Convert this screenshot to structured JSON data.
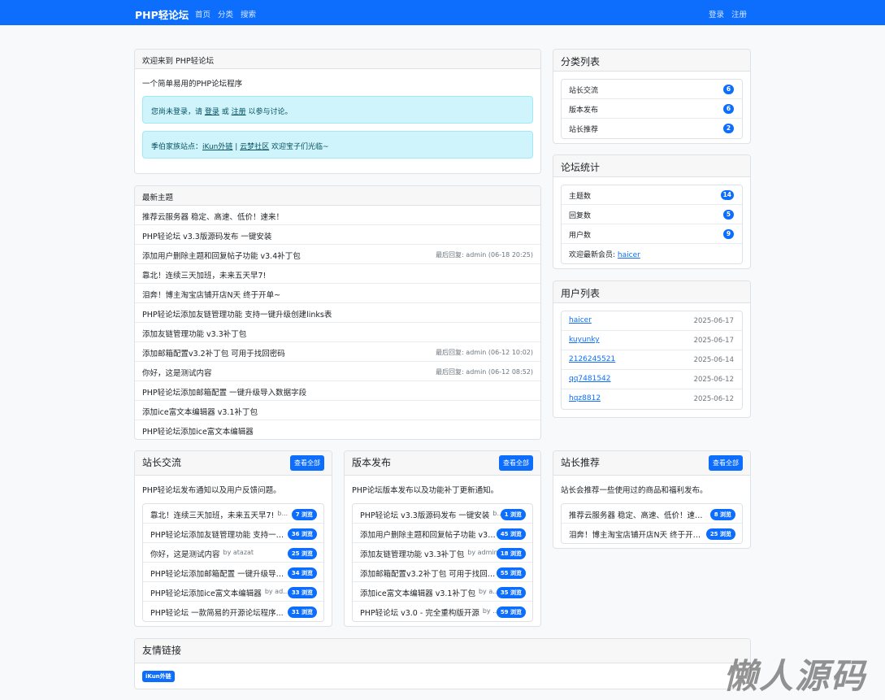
{
  "nav": {
    "brand": "PHP轻论坛",
    "links": [
      "首页",
      "分类",
      "搜索"
    ],
    "login": "登录",
    "register": "注册"
  },
  "welcome": {
    "title": "欢迎来到 PHP轻论坛",
    "desc": "一个简单易用的PHP论坛程序",
    "alert1_pre": "您尚未登录，请 ",
    "alert1_login": "登录",
    "alert1_mid": " 或 ",
    "alert1_register": "注册",
    "alert1_post": " 以参与讨论。",
    "alert2_pre": "季伯家族站点：",
    "alert2_link1": "iKun外链",
    "alert2_sep": " | ",
    "alert2_link2": "云梦社区",
    "alert2_post": " 欢迎宝子们光临~"
  },
  "latest": {
    "title": "最新主题",
    "items": [
      {
        "title": "推荐云服务器 稳定、高速、低价！速来！",
        "meta": ""
      },
      {
        "title": "PHP轻论坛 v3.3版源码发布 一键安装",
        "meta": ""
      },
      {
        "title": "添加用户删除主题和回复帖子功能 v3.4补丁包",
        "meta": "最后回复: admin (06-18 20:25)"
      },
      {
        "title": "靠北！连续三天加班，未来五天早7!",
        "meta": ""
      },
      {
        "title": "泪奔！博主淘宝店铺开店N天 终于开单~",
        "meta": ""
      },
      {
        "title": "PHP轻论坛添加友链管理功能 支持一键升级创建links表",
        "meta": ""
      },
      {
        "title": "添加友链管理功能 v3.3补丁包",
        "meta": ""
      },
      {
        "title": "添加邮箱配置v3.2补丁包 可用于找回密码",
        "meta": "最后回复: admin (06-12 10:02)"
      },
      {
        "title": "你好，这是测试内容",
        "meta": "最后回复: admin (06-12 08:52)"
      },
      {
        "title": "PHP轻论坛添加邮箱配置 一键升级导入数据字段",
        "meta": ""
      },
      {
        "title": "添加ice富文本编辑器 v3.1补丁包",
        "meta": ""
      },
      {
        "title": "PHP轻论坛添加ice富文本编辑器",
        "meta": ""
      }
    ]
  },
  "categories": {
    "title": "分类列表",
    "items": [
      {
        "name": "站长交流",
        "count": "6"
      },
      {
        "name": "版本发布",
        "count": "6"
      },
      {
        "name": "站长推荐",
        "count": "2"
      }
    ]
  },
  "stats": {
    "title": "论坛统计",
    "items": [
      {
        "name": "主题数",
        "count": "14"
      },
      {
        "name": "回复数",
        "count": "5"
      },
      {
        "name": "用户数",
        "count": "9"
      }
    ],
    "newest_label": "欢迎最新会员: ",
    "newest_user": "haicer"
  },
  "users": {
    "title": "用户列表",
    "items": [
      {
        "name": "haicer",
        "date": "2025-06-17"
      },
      {
        "name": "kuyunky",
        "date": "2025-06-17"
      },
      {
        "name": "2126245521",
        "date": "2025-06-14"
      },
      {
        "name": "qq7481542",
        "date": "2025-06-12"
      },
      {
        "name": "hqz8812",
        "date": "2025-06-12"
      }
    ]
  },
  "sections": [
    {
      "title": "站长交流",
      "view_all": "查看全部",
      "desc": "PHP轻论坛发布通知以及用户反馈问题。",
      "items": [
        {
          "title": "靠北！连续三天加班，未来五天早7!",
          "by": "b...",
          "views": "7 浏览"
        },
        {
          "title": "PHP轻论坛添加友链管理功能 支持一键...",
          "by": "",
          "views": "36 浏览"
        },
        {
          "title": "你好，这是测试内容",
          "by": "by atazat",
          "views": "25 浏览"
        },
        {
          "title": "PHP轻论坛添加邮箱配置 一键升级导入...",
          "by": "",
          "views": "34 浏览"
        },
        {
          "title": "PHP轻论坛添加ice富文本编辑器",
          "by": "by ad...",
          "views": "33 浏览"
        },
        {
          "title": "PHP轻论坛 一款简易的开源论坛程序...",
          "by": "",
          "views": "31 浏览"
        }
      ]
    },
    {
      "title": "版本发布",
      "view_all": "查看全部",
      "desc": "PHP论坛版本发布以及功能补丁更新通知。",
      "items": [
        {
          "title": "PHP轻论坛 v3.3版源码发布 一键安装",
          "by": "b...",
          "views": "1 浏览"
        },
        {
          "title": "添加用户删除主题和回复帖子功能 v3.4...",
          "by": "",
          "views": "45 浏览"
        },
        {
          "title": "添加友链管理功能 v3.3补丁包",
          "by": "by admin",
          "views": "18 浏览"
        },
        {
          "title": "添加邮箱配置v3.2补丁包 可用于找回密...",
          "by": "",
          "views": "55 浏览"
        },
        {
          "title": "添加ice富文本编辑器 v3.1补丁包",
          "by": "by a...",
          "views": "35 浏览"
        },
        {
          "title": "PHP轻论坛 v3.0 - 完全重构版开源",
          "by": "by ...",
          "views": "59 浏览"
        }
      ]
    },
    {
      "title": "站长推荐",
      "view_all": "查看全部",
      "desc": "站长会推荐一些使用过的商品和福利发布。",
      "items": [
        {
          "title": "推荐云服务器 稳定、高速、低价！速来...",
          "by": "",
          "views": "8 浏览"
        },
        {
          "title": "泪奔！博主淘宝店铺开店N天 终于开单...",
          "by": "",
          "views": "25 浏览"
        }
      ]
    }
  ],
  "friends": {
    "title": "友情链接",
    "link": "iKun外链"
  },
  "watermark": "懒人源码"
}
